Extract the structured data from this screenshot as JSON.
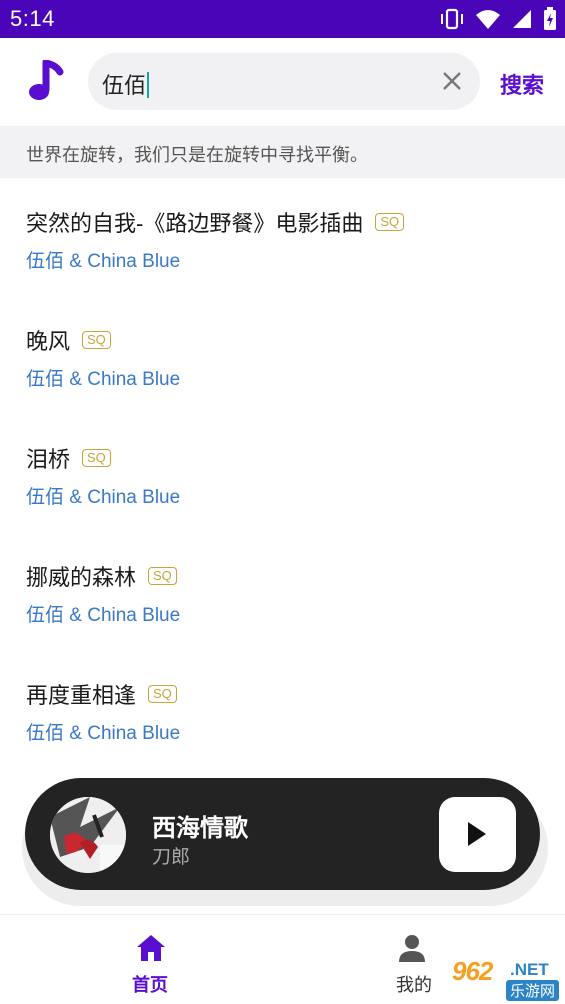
{
  "status_bar": {
    "time": "5:14",
    "icons": [
      "vibrate-icon",
      "wifi-icon",
      "signal-icon",
      "battery-icon"
    ]
  },
  "header": {
    "logo_icon": "music-note-icon",
    "search_value": "伍佰",
    "clear_icon": "close-icon",
    "search_button_label": "搜索"
  },
  "slogan": "世界在旋转，我们只是在旋转中寻找平衡。",
  "songs": [
    {
      "title": "突然的自我-《路边野餐》电影插曲",
      "badge": "SQ",
      "artist": "伍佰 & China Blue"
    },
    {
      "title": "晚风",
      "badge": "SQ",
      "artist": "伍佰 & China Blue"
    },
    {
      "title": "泪桥",
      "badge": "SQ",
      "artist": "伍佰 & China Blue"
    },
    {
      "title": "挪威的森林",
      "badge": "SQ",
      "artist": "伍佰 & China Blue"
    },
    {
      "title": "再度重相逢",
      "badge": "SQ",
      "artist": "伍佰 & China Blue"
    }
  ],
  "player": {
    "title": "西海情歌",
    "artist": "刀郎",
    "play_icon": "play-icon"
  },
  "bottom_nav": [
    {
      "label": "首页",
      "icon": "home-icon",
      "active": true
    },
    {
      "label": "我的",
      "icon": "user-icon",
      "active": false
    }
  ],
  "watermark": {
    "big": "962",
    "net": ".NET",
    "small": "乐游网"
  },
  "colors": {
    "status_bar": "#4a05b8",
    "accent": "#5a0fd0",
    "artist_text": "#3a78c9",
    "sq_badge": "#c9a43a",
    "player_bg": "#232323"
  }
}
